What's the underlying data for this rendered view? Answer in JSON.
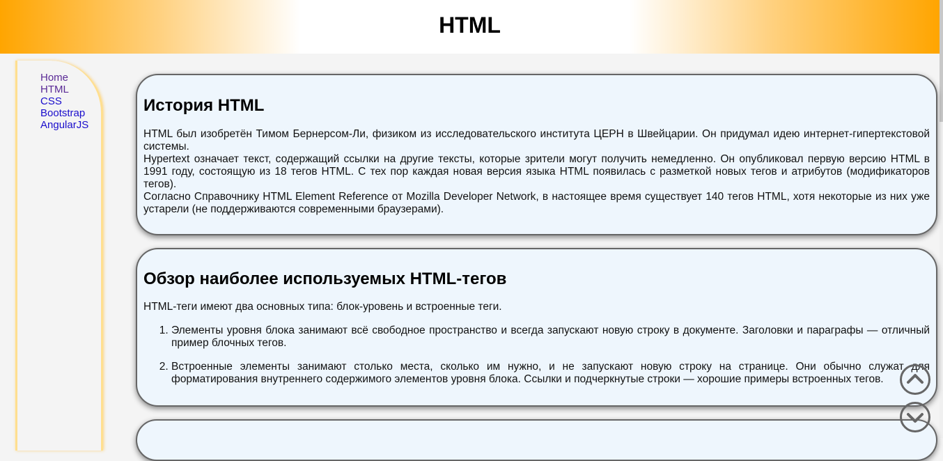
{
  "header": {
    "title": "HTML"
  },
  "sidebar": {
    "items": [
      {
        "label": "Home"
      },
      {
        "label": "HTML"
      },
      {
        "label": "CSS"
      },
      {
        "label": "Bootstrap"
      },
      {
        "label": "AngularJS"
      }
    ]
  },
  "sections": [
    {
      "title": "История HTML",
      "paragraphs": [
        "HTML был изобретён Тимом Бернерсом-Ли, физиком из исследовательского института ЦЕРН в Швейцарии. Он придумал идею интернет-гипертекстовой системы.",
        "Hypertext означает текст, содержащий ссылки на другие тексты, которые зрители могут получить немедленно. Он опубликовал первую версию HTML в 1991 году, состоящую из 18 тегов HTML. С тех пор каждая новая версия языка HTML появилась с разметкой новых тегов и атрибутов (модификаторов тегов).",
        "Согласно Справочнику HTML Element Reference от Mozilla Developer Network, в настоящее время существует 140 тегов HTML, хотя некоторые из них уже устарели (не поддерживаются современными браузерами)."
      ]
    },
    {
      "title": "Обзор наиболее используемых HTML-тегов",
      "intro": "HTML-теги имеют два основных типа: блок-уровень и встроенные теги.",
      "list": [
        "Элементы уровня блока занимают всё свободное пространство и всегда запускают новую строку в документе. Заголовки и параграфы — отличный пример блочных тегов.",
        "Встроенные элементы занимают столько места, сколько им нужно, и не запускают новую строку на странице. Они обычно служат для форматирования внутреннего содержимого элементов уровня блока. Ссылки и подчеркнутые строки — хорошие примеры встроенных тегов."
      ]
    }
  ],
  "icons": {
    "scroll_up": "chevron-up-circle-icon",
    "scroll_down": "chevron-down-circle-icon"
  },
  "colors": {
    "header_accent": "#ffa500",
    "card_background": "#eef6fd",
    "link": "#1a0dcc",
    "link_visited": "#5a2a96"
  }
}
